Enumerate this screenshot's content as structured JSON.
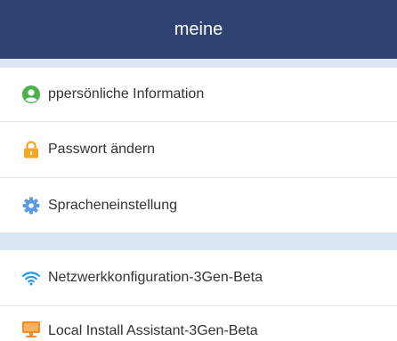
{
  "header": {
    "title": "meine"
  },
  "menu": {
    "items": [
      {
        "label": "ppersönliche Information",
        "icon": "user-icon"
      },
      {
        "label": "Passwort ändern",
        "icon": "lock-icon"
      },
      {
        "label": "Spracheneinstellung",
        "icon": "gear-icon"
      },
      {
        "label": "Netzwerkkonfiguration-3Gen-Beta",
        "icon": "wifi-icon"
      },
      {
        "label": "Local Install Assistant-3Gen-Beta",
        "icon": "monitor-icon"
      }
    ]
  },
  "colors": {
    "header_bg": "#2f4373",
    "section_band": "#dbe7f5",
    "user_icon": "#4caf50",
    "lock_icon": "#f5a623",
    "gear_icon": "#5a9be6",
    "wifi_icon": "#2196f3",
    "monitor_icon": "#f28c28"
  }
}
